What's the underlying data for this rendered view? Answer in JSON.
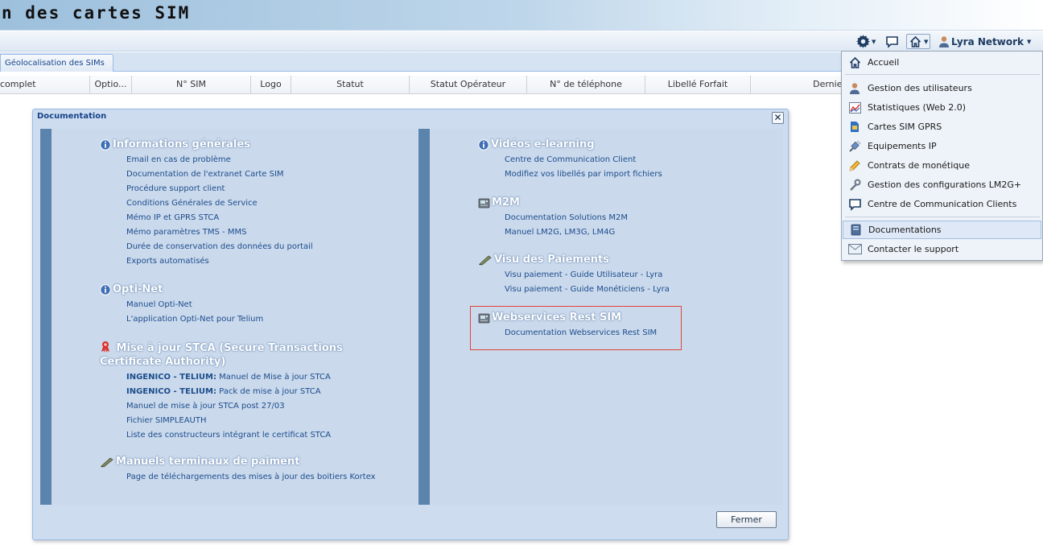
{
  "app": {
    "title": "n des cartes SIM"
  },
  "toolbar": {
    "settings_icon": "gear-icon",
    "comment_icon": "speech-bubble-icon",
    "home_icon": "home-icon",
    "user_label": "Lyra Network"
  },
  "tabs": [
    {
      "label": "Géolocalisation des SIMs"
    }
  ],
  "grid": {
    "columns": [
      "complet",
      "Optio...",
      "N° SIM",
      "Logo",
      "Statut",
      "Statut Opérateur",
      "N° de téléphone",
      "Libellé Forfait",
      "Dernier"
    ]
  },
  "dialog": {
    "title": "Documentation",
    "close_label": "✕",
    "close_button_label": "Fermer",
    "left_sections": [
      {
        "title": "Informations générales",
        "icon": "info-icon",
        "links": [
          "Email en cas de problème",
          "Documentation de l'extranet Carte SIM",
          "Procédure support client",
          "Conditions Générales de Service",
          "Mémo IP et GPRS STCA",
          "Mémo paramètres TMS - MMS",
          "Durée de conservation des données du portail",
          "Exports automatisés"
        ]
      },
      {
        "title": "Opti-Net",
        "icon": "info-icon",
        "links": [
          "Manuel Opti-Net",
          "L'application Opti-Net pour Telium"
        ]
      },
      {
        "title": "Mise à jour STCA (Secure Transactions Certificate Authority)",
        "icon": "ribbon-icon",
        "links": [
          {
            "bold": "INGENICO - TELIUM:",
            "text": " Manuel de Mise à jour STCA"
          },
          {
            "bold": "INGENICO - TELIUM:",
            "text": " Pack de mise à jour STCA"
          },
          {
            "bold": "",
            "text": "Manuel de mise à jour STCA post 27/03"
          },
          {
            "bold": "",
            "text": "Fichier SIMPLEAUTH"
          },
          {
            "bold": "",
            "text": "Liste des constructeurs intégrant le certificat STCA"
          }
        ]
      },
      {
        "title": "Manuels terminaux de paiment",
        "icon": "pen-icon",
        "links": [
          "Page de téléchargements des mises à jour des boitiers Kortex"
        ]
      }
    ],
    "right_sections": [
      {
        "title": "Vidéos e-learning",
        "icon": "info-icon",
        "links": [
          "Centre de Communication Client",
          "Modifiez vos libellés par import fichiers"
        ]
      },
      {
        "title": "M2M",
        "icon": "device-icon",
        "links": [
          "Documentation Solutions M2M",
          "Manuel LM2G, LM3G, LM4G"
        ]
      },
      {
        "title": "Visu des Paiements",
        "icon": "pen-icon",
        "links": [
          "Visu paiement - Guide Utilisateur - Lyra",
          "Visu paiement - Guide Monéticiens - Lyra"
        ]
      },
      {
        "title": "Webservices Rest SIM",
        "icon": "device-icon",
        "links": [
          "Documentation Webservices Rest SIM"
        ]
      }
    ]
  },
  "home_menu": {
    "items": [
      {
        "label": "Accueil",
        "icon": "home-icon"
      },
      {
        "label": "Gestion des utilisateurs",
        "icon": "user-icon"
      },
      {
        "label": "Statistiques (Web 2.0)",
        "icon": "chart-icon"
      },
      {
        "label": "Cartes SIM GPRS",
        "icon": "sim-card-icon"
      },
      {
        "label": "Equipements IP",
        "icon": "cable-icon"
      },
      {
        "label": "Contrats de monétique",
        "icon": "pencil-icon"
      },
      {
        "label": "Gestion des configurations LM2G+",
        "icon": "wrench-icon"
      },
      {
        "label": "Centre de Communication Clients",
        "icon": "speech-bubble-icon"
      },
      {
        "label": "Documentations",
        "icon": "book-icon"
      },
      {
        "label": "Contacter le support",
        "icon": "envelope-icon"
      }
    ],
    "active_item": "Documentations"
  },
  "colors": {
    "accent": "#15428b",
    "link": "#1c4d8c",
    "highlight_border": "#e0453a",
    "sidebar_bar": "#5b84ad"
  }
}
